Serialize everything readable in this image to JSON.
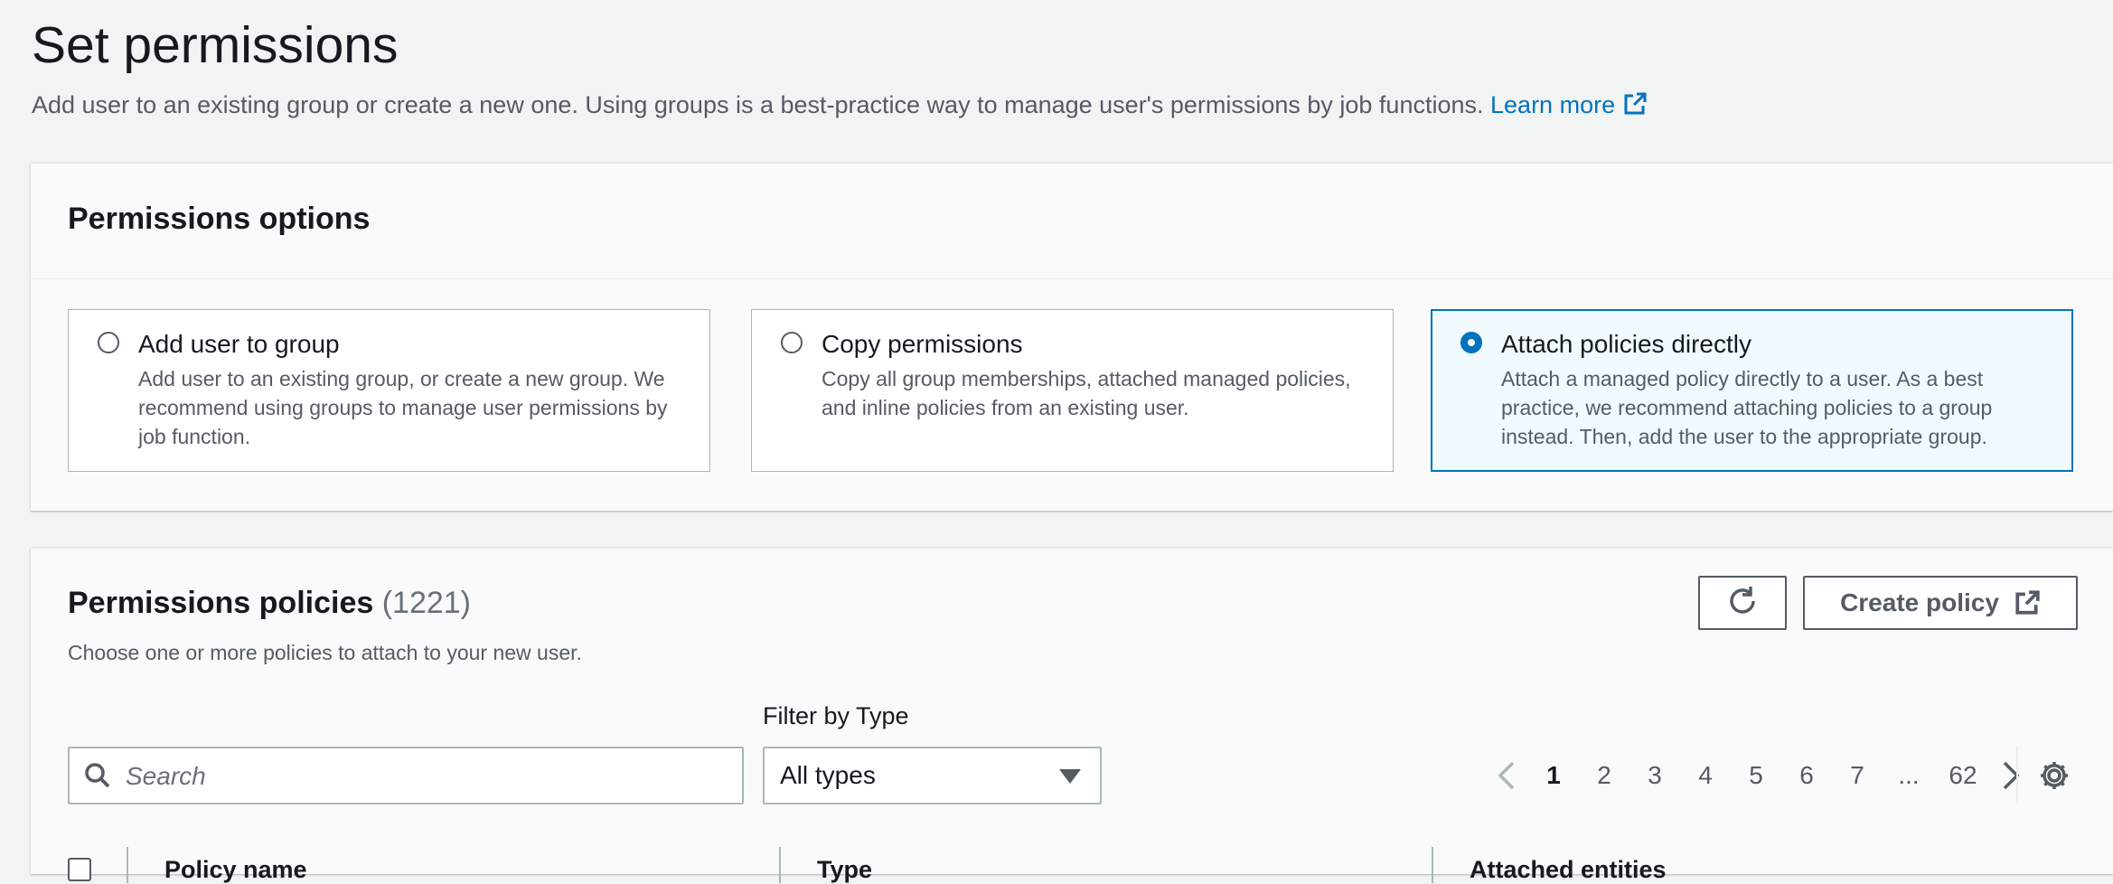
{
  "page": {
    "title": "Set permissions",
    "description": "Add user to an existing group or create a new one. Using groups is a best-practice way to manage user's permissions by job functions.",
    "learn_more": "Learn more"
  },
  "permissions_options": {
    "title": "Permissions options",
    "tiles": [
      {
        "title": "Add user to group",
        "description": "Add user to an existing group, or create a new group. We recommend using groups to manage user permissions by job function.",
        "selected": false
      },
      {
        "title": "Copy permissions",
        "description": "Copy all group memberships, attached managed policies, and inline policies from an existing user.",
        "selected": false
      },
      {
        "title": "Attach policies directly",
        "description": "Attach a managed policy directly to a user. As a best practice, we recommend attaching policies to a group instead. Then, add the user to the appropriate group.",
        "selected": true
      }
    ]
  },
  "permissions_policies": {
    "title": "Permissions policies",
    "count": "(1221)",
    "description": "Choose one or more policies to attach to your new user.",
    "refresh_icon": "refresh-icon",
    "create_policy": "Create policy",
    "search_placeholder": "Search",
    "filter_label": "Filter by Type",
    "filter_value": "All types",
    "pagination": {
      "pages": [
        "1",
        "2",
        "3",
        "4",
        "5",
        "6",
        "7",
        "...",
        "62"
      ],
      "current": "1"
    },
    "columns": [
      "Policy name",
      "Type",
      "Attached entities"
    ]
  },
  "colors": {
    "accent": "#0073bb",
    "background": "#f2f3f3",
    "panel": "#fafafa",
    "text": "#16191f",
    "secondary_text": "#545b64"
  }
}
